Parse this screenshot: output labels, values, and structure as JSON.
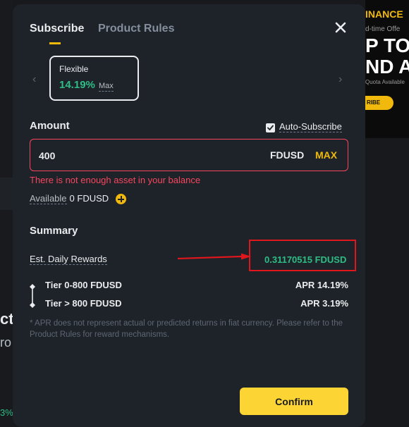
{
  "background": {
    "left_fragments": [
      "ct",
      "ro",
      "3%"
    ],
    "banner": {
      "line1": "INANCE",
      "line2": "d-time Offe",
      "line3": "P TO",
      "line4": "ND A",
      "line5": "Quota Available",
      "button": "RIBE"
    }
  },
  "modal": {
    "tabs": [
      {
        "label": "Subscribe",
        "active": true
      },
      {
        "label": "Product Rules",
        "active": false
      }
    ],
    "term": {
      "name": "Flexible",
      "apr": "14.19%",
      "max_label": "Max"
    },
    "amount": {
      "label": "Amount",
      "auto_subscribe_label": "Auto-Subscribe",
      "auto_subscribe_checked": true,
      "value": "400",
      "unit": "FDUSD",
      "max_button": "MAX",
      "error": "There is not enough asset in your balance"
    },
    "available": {
      "label": "Available",
      "value": "0 FDUSD"
    },
    "summary": {
      "title": "Summary",
      "est_daily_rewards_label": "Est. Daily Rewards",
      "est_daily_rewards_value": "0.31170515 FDUSD",
      "tiers": [
        {
          "label": "Tier 0-800 FDUSD",
          "apr": "APR 14.19%"
        },
        {
          "label": "Tier > 800 FDUSD",
          "apr": "APR 3.19%"
        }
      ],
      "disclaimer": "* APR does not represent actual or predicted returns in fiat currency. Please refer to the Product Rules for reward mechanisms."
    },
    "confirm_label": "Confirm"
  },
  "colors": {
    "accent": "#f0b90b",
    "positive": "#2ebd85",
    "error": "#f6465d",
    "annotation": "#e0161d"
  }
}
